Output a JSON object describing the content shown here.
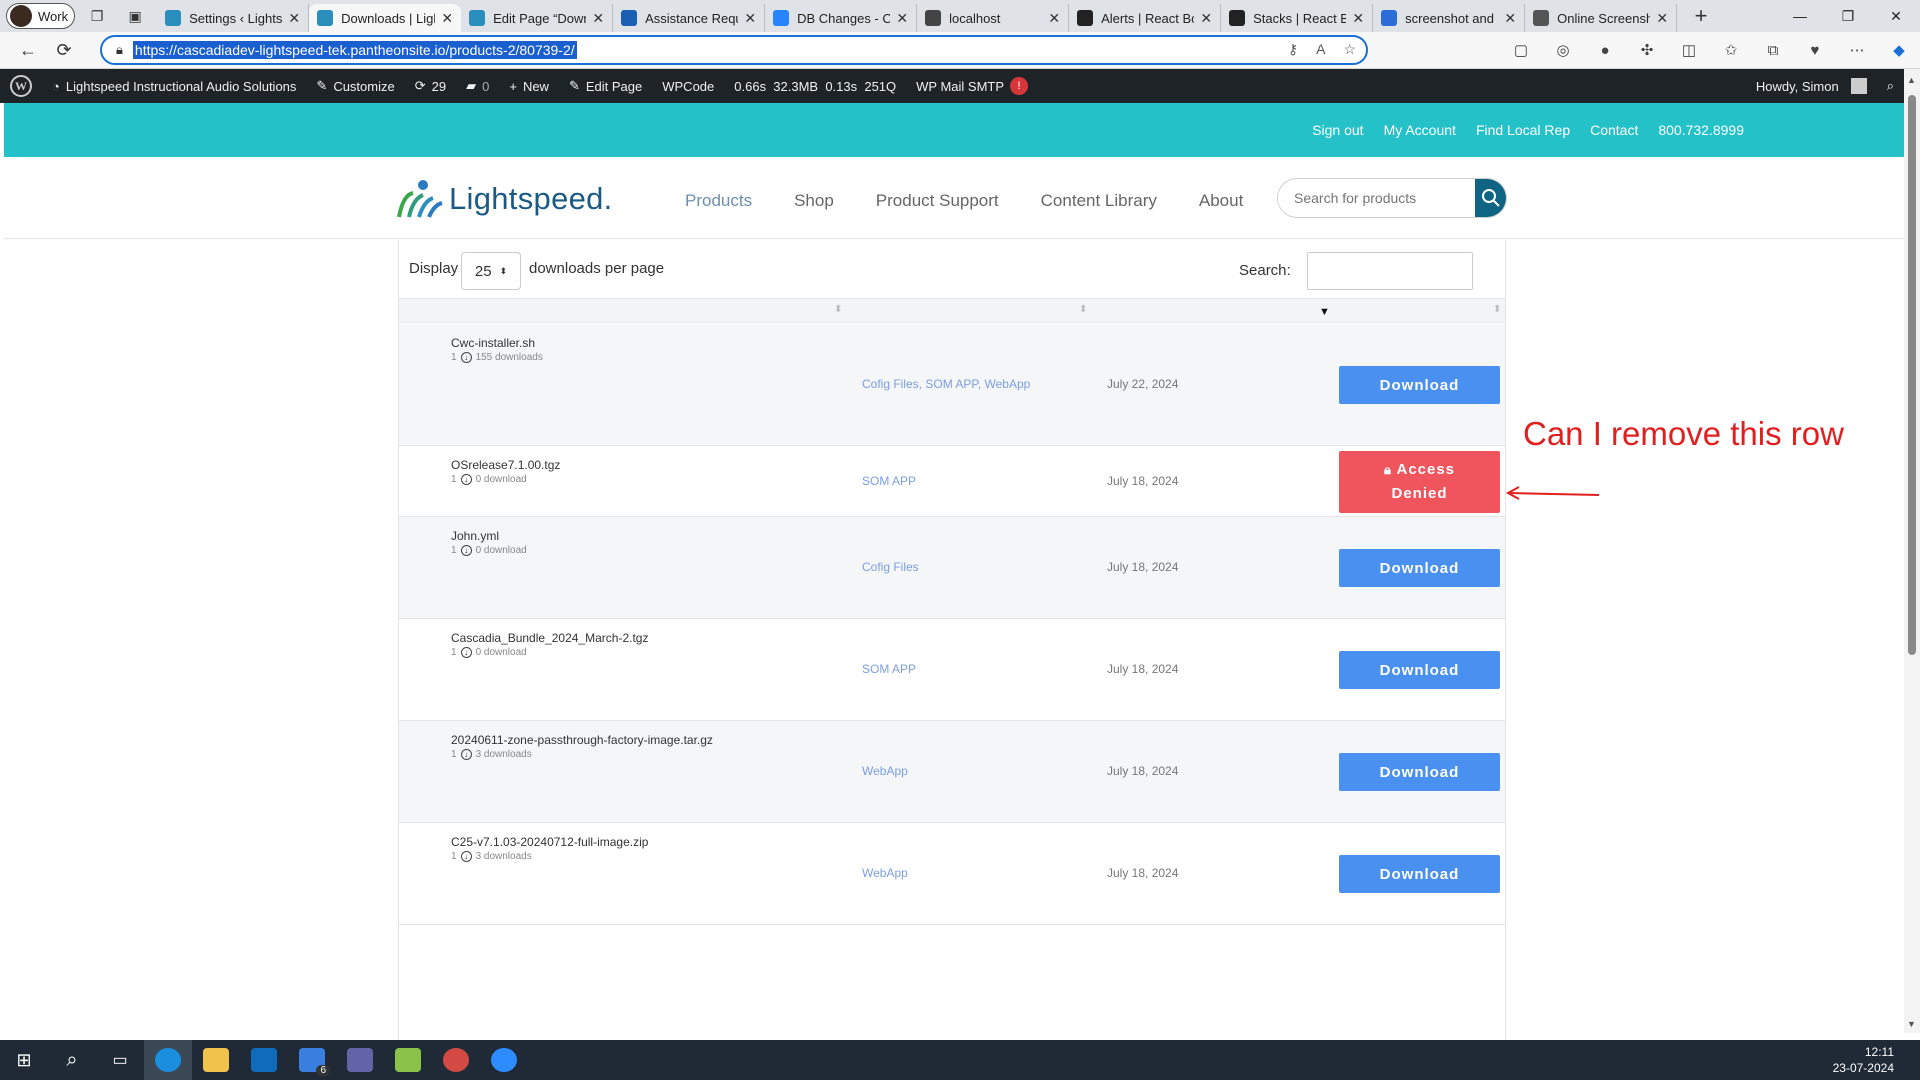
{
  "browser": {
    "profile": "Work",
    "tabs": [
      {
        "title": "Settings ‹ Lightsp",
        "fav": "#2a8fbd"
      },
      {
        "title": "Downloads | Light",
        "fav": "#2a8fbd"
      },
      {
        "title": "Edit Page “Down",
        "fav": "#2a8fbd"
      },
      {
        "title": "Assistance Requ",
        "fav": "#1a5fb4"
      },
      {
        "title": "DB Changes - Ca",
        "fav": "#2684ff"
      },
      {
        "title": "localhost",
        "fav": "#444"
      },
      {
        "title": "Alerts | React Bo",
        "fav": "#222"
      },
      {
        "title": "Stacks | React Bo",
        "fav": "#222"
      },
      {
        "title": "screenshot and s",
        "fav": "#2b6cd6"
      },
      {
        "title": "Online Screensh",
        "fav": "#555"
      }
    ],
    "url": "https://cascadiadev-lightspeed-tek.pantheonsite.io/products-2/80739-2/"
  },
  "wpbar": {
    "site": "Lightspeed Instructional Audio Solutions",
    "customize": "Customize",
    "updates": "29",
    "comments": "0",
    "new": "New",
    "edit": "Edit Page",
    "wpcode": "WPCode",
    "perf": "0.66s  32.3MB  0.13s  251Q",
    "smtp": "WP Mail SMTP",
    "smtp_badge": "!",
    "howdy": "Howdy, Simon"
  },
  "topbar": {
    "links": [
      "Sign out",
      "My Account",
      "Find Local Rep",
      "Contact",
      "800.732.8999"
    ]
  },
  "site": {
    "logo_text": "Lightspeed.",
    "nav": [
      "Products",
      "Shop",
      "Product Support",
      "Content Library",
      "About"
    ],
    "search_placeholder": "Search for products"
  },
  "table": {
    "display_label": "Display",
    "per_page_value": "25",
    "per_page_suffix": "downloads per page",
    "search_label": "Search:",
    "rows": [
      {
        "name": "Cwc-installer.sh",
        "version": "1",
        "count": "155 downloads",
        "cats": "Cofig Files, SOM APP, WebApp",
        "date": "July 22, 2024",
        "action": "Download"
      },
      {
        "name": "OSrelease7.1.00.tgz",
        "version": "1",
        "count": "0 download",
        "cats": "SOM APP",
        "date": "July 18, 2024",
        "action": "Access Denied"
      },
      {
        "name": "John.yml",
        "version": "1",
        "count": "0 download",
        "cats": "Cofig Files",
        "date": "July 18, 2024",
        "action": "Download"
      },
      {
        "name": "Cascadia_Bundle_2024_March-2.tgz",
        "version": "1",
        "count": "0 download",
        "cats": "SOM APP",
        "date": "July 18, 2024",
        "action": "Download"
      },
      {
        "name": "20240611-zone-passthrough-factory-image.tar.gz",
        "version": "1",
        "count": "3 downloads",
        "cats": "WebApp",
        "date": "July 18, 2024",
        "action": "Download"
      },
      {
        "name": "C25-v7.1.03-20240712-full-image.zip",
        "version": "1",
        "count": "3 downloads",
        "cats": "WebApp",
        "date": "July 18, 2024",
        "action": "Download"
      }
    ]
  },
  "annotation": "Can I remove this row",
  "taskbar": {
    "time": "12:11",
    "date": "23-07-2024",
    "teams_badge": "6"
  }
}
